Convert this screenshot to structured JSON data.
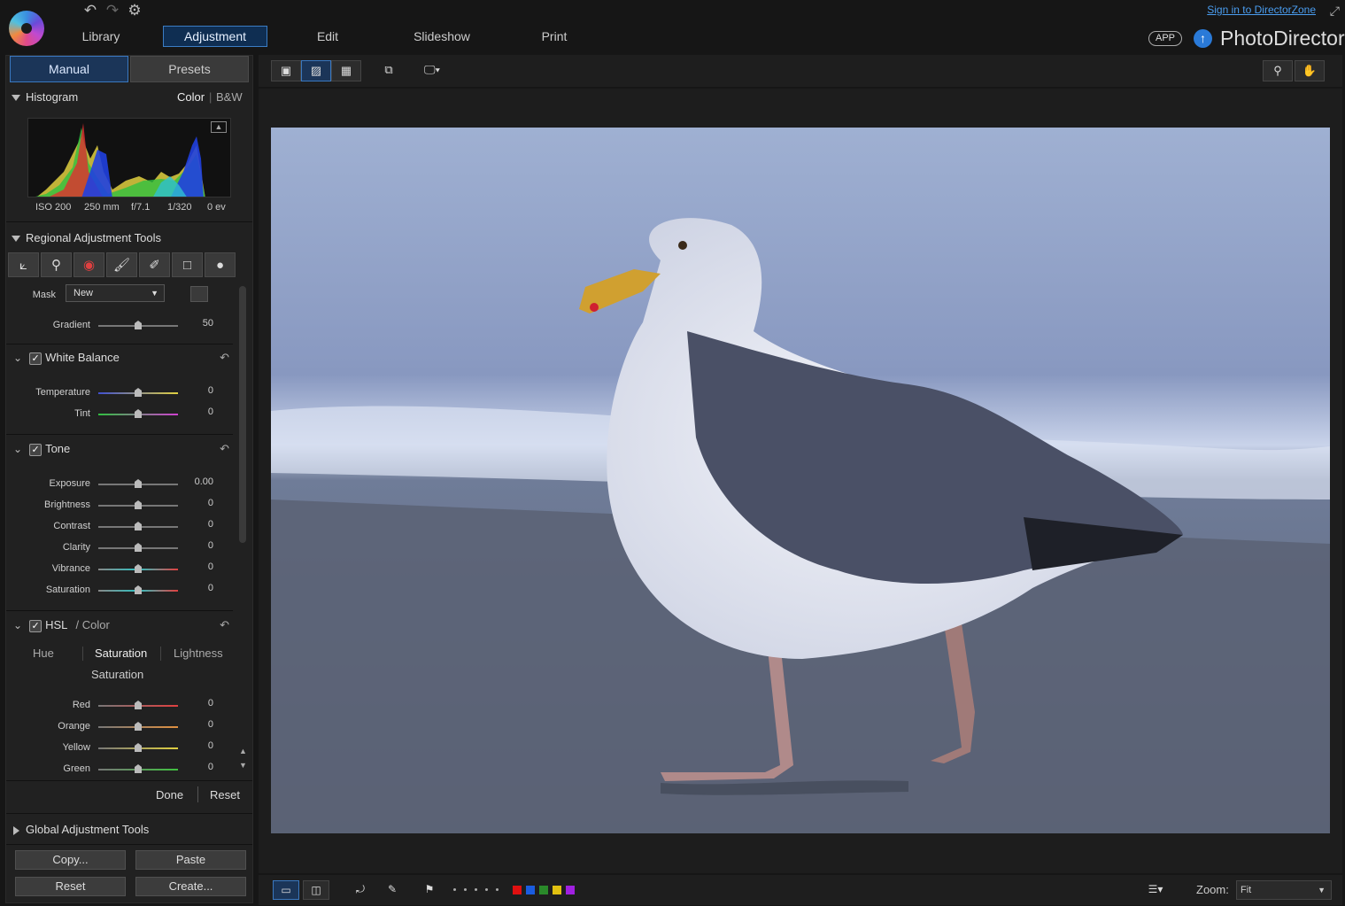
{
  "app": {
    "name": "PhotoDirector",
    "app_badge": "APP",
    "signin": "Sign in to DirectorZone"
  },
  "nav": {
    "items": [
      "Library",
      "Adjustment",
      "Edit",
      "Slideshow",
      "Print"
    ],
    "active": "Adjustment"
  },
  "panel_tabs": {
    "manual": "Manual",
    "presets": "Presets"
  },
  "histogram": {
    "title": "Histogram",
    "color": "Color",
    "bw": "B&W",
    "exif": [
      "ISO 200",
      "250 mm",
      "f/7.1",
      "1/320",
      "0 ev"
    ]
  },
  "regional": {
    "title": "Regional Adjustment Tools",
    "mask_label": "Mask",
    "mask_value": "New",
    "gradient_label": "Gradient",
    "gradient_value": "50"
  },
  "white_balance": {
    "title": "White Balance",
    "rows": [
      {
        "label": "Temperature",
        "value": "0"
      },
      {
        "label": "Tint",
        "value": "0"
      }
    ]
  },
  "tone": {
    "title": "Tone",
    "rows": [
      {
        "label": "Exposure",
        "value": "0.00"
      },
      {
        "label": "Brightness",
        "value": "0"
      },
      {
        "label": "Contrast",
        "value": "0"
      },
      {
        "label": "Clarity",
        "value": "0"
      },
      {
        "label": "Vibrance",
        "value": "0"
      },
      {
        "label": "Saturation",
        "value": "0"
      }
    ]
  },
  "hsl": {
    "title": "HSL",
    "sub": "/ Color",
    "tabs": [
      "Hue",
      "Saturation",
      "Lightness"
    ],
    "active_tab": "Saturation",
    "heading": "Saturation",
    "rows": [
      {
        "label": "Red",
        "value": "0"
      },
      {
        "label": "Orange",
        "value": "0"
      },
      {
        "label": "Yellow",
        "value": "0"
      },
      {
        "label": "Green",
        "value": "0"
      }
    ]
  },
  "actions": {
    "done": "Done",
    "reset": "Reset"
  },
  "global": {
    "title": "Global Adjustment Tools"
  },
  "bottom_buttons": {
    "copy": "Copy...",
    "paste": "Paste",
    "reset": "Reset",
    "create": "Create..."
  },
  "zoom": {
    "label": "Zoom:",
    "value": "Fit"
  },
  "colors": {
    "accent": "#3b7dc4",
    "label_colors": [
      "#e01010",
      "#1a5ce0",
      "#2a8a2a",
      "#e0c010",
      "#a020e0"
    ]
  }
}
